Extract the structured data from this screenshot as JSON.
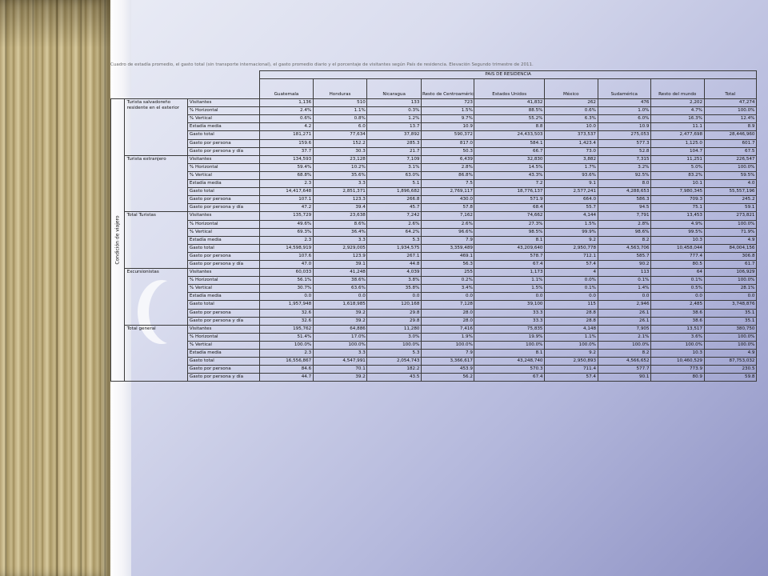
{
  "caption": "Cuadro de estadía promedio, el gasto total (sin transporte internacional), el gasto promedio diario y el porcentaje de visitantes según País de residencia. Elevación Segundo trimestre de 2011.",
  "header": {
    "country_group": "PAIS DE RESIDENCIA",
    "row_axis_label": "Condición de viajero",
    "columns": [
      "Guatemala",
      "Honduras",
      "Nicaragua",
      "Resto de Centroamérica",
      "Estados Unidos",
      "México",
      "Sudamérica",
      "Resto del mundo",
      "Total"
    ]
  },
  "groups": [
    {
      "label": "Turista salvadoreño residente en el exterior",
      "rows": [
        {
          "metric": "Visitantes",
          "values": [
            "1,136",
            "510",
            "133",
            "723",
            "41,832",
            "262",
            "476",
            "2,202",
            "47,274"
          ]
        },
        {
          "metric": "% Horizontal",
          "values": [
            "2.4%",
            "1.1%",
            "0.3%",
            "1.5%",
            "88.5%",
            "0.6%",
            "1.0%",
            "4.7%",
            "100.0%"
          ]
        },
        {
          "metric": "% Vertical",
          "values": [
            "0.6%",
            "0.8%",
            "1.2%",
            "9.7%",
            "55.2%",
            "6.3%",
            "6.0%",
            "16.3%",
            "12.4%"
          ]
        },
        {
          "metric": "Estadía media",
          "values": [
            "4.2",
            "6.0",
            "13.7",
            "10.9",
            "8.8",
            "10.0",
            "10.9",
            "11.1",
            "8.9"
          ]
        },
        {
          "metric": "Gasto total",
          "values": [
            "181,271",
            "77,634",
            "37,892",
            "590,372",
            "24,433,503",
            "373,537",
            "275,053",
            "2,477,698",
            "28,446,960"
          ]
        },
        {
          "metric": "Gasto por persona",
          "values": [
            "159.6",
            "152.2",
            "285.3",
            "817.0",
            "584.1",
            "1,423.4",
            "577.3",
            "1,125.0",
            "601.7"
          ]
        },
        {
          "metric": "Gasto por persona y día",
          "values": [
            "37.7",
            "30.3",
            "21.7",
            "50.3",
            "66.7",
            "73.0",
            "52.8",
            "104.7",
            "67.5"
          ]
        }
      ]
    },
    {
      "label": "Turista extranjero",
      "rows": [
        {
          "metric": "Visitantes",
          "values": [
            "134,593",
            "23,128",
            "7,109",
            "6,439",
            "32,830",
            "3,882",
            "7,315",
            "11,251",
            "226,547"
          ]
        },
        {
          "metric": "% Horizontal",
          "values": [
            "59.4%",
            "10.2%",
            "3.1%",
            "2.8%",
            "14.5%",
            "1.7%",
            "3.2%",
            "5.0%",
            "100.0%"
          ]
        },
        {
          "metric": "% Vertical",
          "values": [
            "68.8%",
            "35.6%",
            "63.0%",
            "86.8%",
            "43.3%",
            "93.6%",
            "92.5%",
            "83.2%",
            "59.5%"
          ]
        },
        {
          "metric": "Estadía media",
          "values": [
            "2.3",
            "3.3",
            "5.1",
            "7.5",
            "7.2",
            "9.1",
            "8.0",
            "10.1",
            "4.0"
          ]
        },
        {
          "metric": "Gasto total",
          "values": [
            "14,417,648",
            "2,851,371",
            "1,896,682",
            "2,769,117",
            "18,776,137",
            "2,577,241",
            "4,288,653",
            "7,980,345",
            "55,557,196"
          ]
        },
        {
          "metric": "Gasto por persona",
          "values": [
            "107.1",
            "123.3",
            "266.8",
            "430.0",
            "571.9",
            "664.0",
            "586.3",
            "709.3",
            "245.2"
          ]
        },
        {
          "metric": "Gasto por persona y día",
          "values": [
            "47.2",
            "39.4",
            "45.7",
            "57.8",
            "68.4",
            "55.7",
            "94.5",
            "75.1",
            "59.1"
          ]
        }
      ]
    },
    {
      "label": "Total Turistas",
      "rows": [
        {
          "metric": "Visitantes",
          "values": [
            "135,729",
            "23,638",
            "7,242",
            "7,162",
            "74,662",
            "4,144",
            "7,791",
            "13,453",
            "273,821"
          ]
        },
        {
          "metric": "% Horizontal",
          "values": [
            "49.6%",
            "8.6%",
            "2.6%",
            "2.6%",
            "27.3%",
            "1.5%",
            "2.8%",
            "4.9%",
            "100.0%"
          ]
        },
        {
          "metric": "% Vertical",
          "values": [
            "69.3%",
            "36.4%",
            "64.2%",
            "96.6%",
            "98.5%",
            "99.9%",
            "98.6%",
            "99.5%",
            "71.9%"
          ]
        },
        {
          "metric": "Estadía media",
          "values": [
            "2.3",
            "3.3",
            "5.3",
            "7.9",
            "8.1",
            "9.2",
            "8.2",
            "10.3",
            "4.9"
          ]
        },
        {
          "metric": "Gasto total",
          "values": [
            "14,598,919",
            "2,929,005",
            "1,934,575",
            "3,359,489",
            "43,209,640",
            "2,950,778",
            "4,563,706",
            "10,458,044",
            "84,004,156"
          ]
        },
        {
          "metric": "Gasto por persona",
          "values": [
            "107.6",
            "123.9",
            "267.1",
            "469.1",
            "578.7",
            "712.1",
            "585.7",
            "777.4",
            "306.8"
          ]
        },
        {
          "metric": "Gasto por persona y día",
          "values": [
            "47.0",
            "39.1",
            "44.8",
            "56.3",
            "67.4",
            "57.4",
            "90.2",
            "80.5",
            "61.7"
          ]
        }
      ]
    },
    {
      "label": "Excursionistas",
      "rows": [
        {
          "metric": "Visitantes",
          "values": [
            "60,033",
            "41,248",
            "4,039",
            "255",
            "1,173",
            "4",
            "113",
            "64",
            "106,929"
          ]
        },
        {
          "metric": "% Horizontal",
          "values": [
            "56.1%",
            "38.6%",
            "3.8%",
            "0.2%",
            "1.1%",
            "0.0%",
            "0.1%",
            "0.1%",
            "100.0%"
          ]
        },
        {
          "metric": "% Vertical",
          "values": [
            "30.7%",
            "63.6%",
            "35.8%",
            "3.4%",
            "1.5%",
            "0.1%",
            "1.4%",
            "0.5%",
            "28.1%"
          ]
        },
        {
          "metric": "Estadía media",
          "values": [
            "0.0",
            "0.0",
            "0.0",
            "0.0",
            "0.0",
            "0.0",
            "0.0",
            "0.0",
            "0.0"
          ]
        },
        {
          "metric": "Gasto total",
          "values": [
            "1,957,948",
            "1,618,985",
            "120,168",
            "7,128",
            "39,100",
            "115",
            "2,946",
            "2,485",
            "3,748,876"
          ]
        },
        {
          "metric": "Gasto por persona",
          "values": [
            "32.6",
            "39.2",
            "29.8",
            "28.0",
            "33.3",
            "28.8",
            "26.1",
            "38.6",
            "35.1"
          ]
        },
        {
          "metric": "Gasto por persona y día",
          "values": [
            "32.6",
            "39.2",
            "29.8",
            "28.0",
            "33.3",
            "28.8",
            "26.1",
            "38.6",
            "35.1"
          ]
        }
      ]
    },
    {
      "label": "Total general",
      "rows": [
        {
          "metric": "Visitantes",
          "values": [
            "195,762",
            "64,886",
            "11,280",
            "7,416",
            "75,835",
            "4,148",
            "7,905",
            "13,517",
            "380,750"
          ]
        },
        {
          "metric": "% Horizontal",
          "values": [
            "51.4%",
            "17.0%",
            "3.0%",
            "1.9%",
            "19.9%",
            "1.1%",
            "2.1%",
            "3.6%",
            "100.0%"
          ]
        },
        {
          "metric": "% Vertical",
          "values": [
            "100.0%",
            "100.0%",
            "100.0%",
            "100.0%",
            "100.0%",
            "100.0%",
            "100.0%",
            "100.0%",
            "100.0%"
          ]
        },
        {
          "metric": "Estadía media",
          "values": [
            "2.3",
            "3.3",
            "5.3",
            "7.9",
            "8.1",
            "9.2",
            "8.2",
            "10.3",
            "4.9"
          ]
        },
        {
          "metric": "Gasto total",
          "values": [
            "16,556,867",
            "4,547,991",
            "2,054,743",
            "3,366,617",
            "43,248,740",
            "2,950,893",
            "4,566,652",
            "10,460,529",
            "87,753,032"
          ]
        },
        {
          "metric": "Gasto por persona",
          "values": [
            "84.6",
            "70.1",
            "182.2",
            "453.9",
            "570.3",
            "711.4",
            "577.7",
            "773.9",
            "230.5"
          ]
        },
        {
          "metric": "Gasto por persona y día",
          "values": [
            "44.7",
            "39.2",
            "43.5",
            "56.2",
            "67.4",
            "57.4",
            "90.1",
            "80.9",
            "59.8"
          ]
        }
      ]
    }
  ]
}
